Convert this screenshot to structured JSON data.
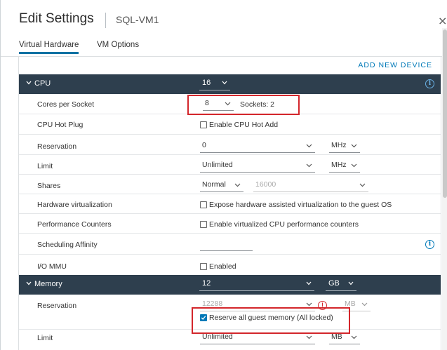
{
  "dialog": {
    "title": "Edit Settings",
    "vm_name": "SQL-VM1",
    "close_glyph": "×"
  },
  "tabs": [
    {
      "label": "Virtual Hardware",
      "active": true
    },
    {
      "label": "VM Options",
      "active": false
    }
  ],
  "add_device_label": "ADD NEW DEVICE",
  "cpu": {
    "label": "CPU",
    "value": "16",
    "cores_per_socket": {
      "label": "Cores per Socket",
      "value": "8",
      "sockets_text": "Sockets: 2"
    },
    "hot_plug": {
      "label": "CPU Hot Plug",
      "option": "Enable CPU Hot Add",
      "checked": false
    },
    "reservation": {
      "label": "Reservation",
      "value": "0",
      "unit": "MHz"
    },
    "limit": {
      "label": "Limit",
      "value": "Unlimited",
      "unit": "MHz"
    },
    "shares": {
      "label": "Shares",
      "level": "Normal",
      "value": "16000"
    },
    "hw_virtualization": {
      "label": "Hardware virtualization",
      "option": "Expose hardware assisted virtualization to the guest OS",
      "checked": false
    },
    "perf_counters": {
      "label": "Performance Counters",
      "option": "Enable virtualized CPU performance counters",
      "checked": false
    },
    "scheduling_affinity": {
      "label": "Scheduling Affinity",
      "value": ""
    },
    "io_mmu": {
      "label": "I/O MMU",
      "option": "Enabled",
      "checked": false
    }
  },
  "memory": {
    "label": "Memory",
    "value": "12",
    "unit": "GB",
    "reservation": {
      "label": "Reservation",
      "value": "12288",
      "unit": "MB",
      "reserve_all_option": "Reserve all guest memory (All locked)",
      "reserve_all_checked": true
    },
    "limit": {
      "label": "Limit",
      "value": "Unlimited",
      "unit": "MB"
    }
  },
  "colors": {
    "section_header": "#2e3f4e",
    "accent": "#0079b8",
    "highlight_box": "#d3262b"
  },
  "icons": {
    "info": "i",
    "warning": "!"
  }
}
